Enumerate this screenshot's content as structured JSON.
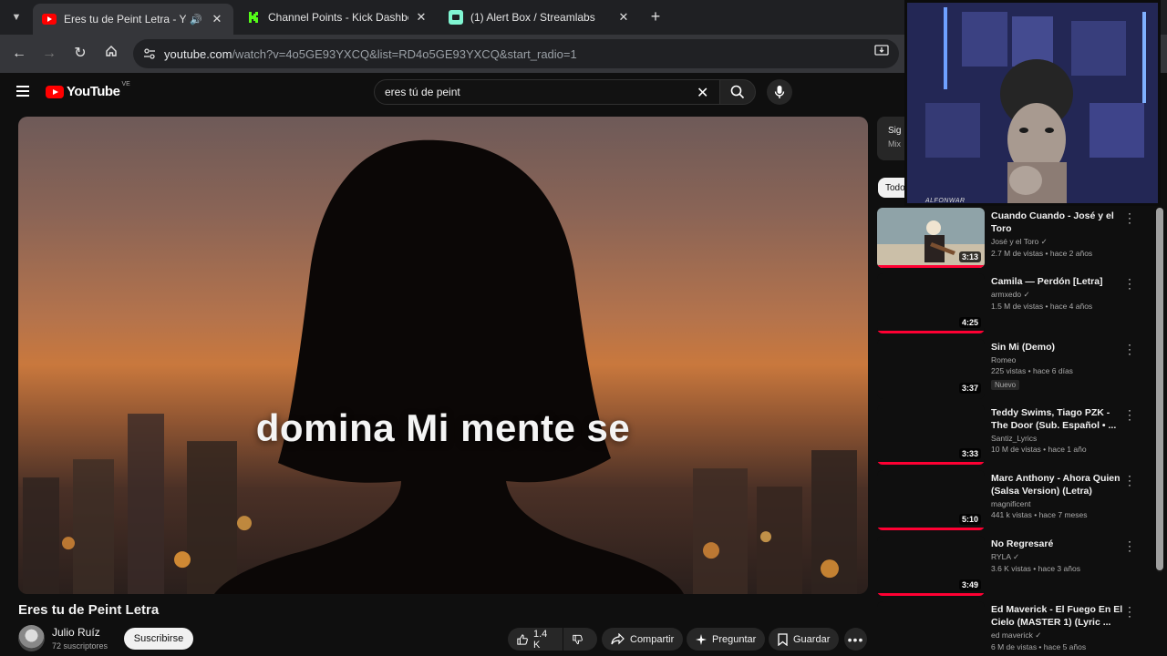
{
  "browser": {
    "tabs": [
      {
        "title": "Eres tu de Peint Letra - YouTube",
        "favicon": "youtube-favicon",
        "active": true
      },
      {
        "title": "Channel Points - Kick Dashboard",
        "favicon": "kick-favicon",
        "active": false
      },
      {
        "title": "(1) Alert Box / Streamlabs",
        "favicon": "streamlabs-favicon",
        "active": false
      }
    ],
    "url": {
      "host": "youtube.com",
      "path": "/watch?v=4o5GE93YXCQ&list=RD4o5GE93YXCQ&start_radio=1"
    }
  },
  "youtube": {
    "logo_text": "YouTube",
    "country_code": "VE",
    "search_value": "eres tú de peint"
  },
  "video": {
    "lyric": "domina Mi mente se",
    "title": "Eres tu de Peint Letra",
    "channel": "Julio Ruíz",
    "subscribers": "72 suscriptores",
    "subscribe_label": "Suscribirse",
    "likes": "1.4 K",
    "share_label": "Compartir",
    "ask_label": "Preguntar",
    "save_label": "Guardar"
  },
  "sidebar": {
    "top_line1": "Sig",
    "top_line2": "Mix",
    "chip": "Todo"
  },
  "webcam": {
    "tag": "ALFONWAR"
  },
  "recommendations": [
    {
      "title": "Cuando Cuando - José y el Toro",
      "channel": "José y el Toro",
      "verified": true,
      "meta": "2.7 M de vistas • hace 2 años",
      "duration": "3:13",
      "badge": "",
      "progress": 1.0
    },
    {
      "title": "Camila — Perdón [Letra]",
      "channel": "armxedo",
      "verified": true,
      "meta": "1.5 M de vistas • hace 4 años",
      "duration": "4:25",
      "badge": "",
      "progress": 1.0
    },
    {
      "title": "Sin Mi (Demo)",
      "channel": "Romeo",
      "verified": false,
      "meta": "225 vistas • hace 6 días",
      "duration": "3:37",
      "badge": "Nuevo",
      "progress": 0
    },
    {
      "title": "Teddy Swims, Tiago PZK - The Door (Sub. Español • ...",
      "channel": "Santiz_Lyrics",
      "verified": false,
      "meta": "10 M de vistas • hace 1 año",
      "duration": "3:33",
      "badge": "",
      "progress": 1.0
    },
    {
      "title": "Marc Anthony - Ahora Quien (Salsa Version) (Letra)",
      "channel": "magnificent",
      "verified": false,
      "meta": "441 k vistas • hace 7 meses",
      "duration": "5:10",
      "badge": "",
      "progress": 1.0
    },
    {
      "title": "No Regresaré",
      "channel": "RYLA",
      "verified": true,
      "meta": "3.6 K vistas • hace 3 años",
      "duration": "3:49",
      "badge": "",
      "progress": 1.0
    },
    {
      "title": "Ed Maverick - El Fuego En El Cielo (MASTER 1) (Lyric ...",
      "channel": "ed maverick",
      "verified": true,
      "meta": "6 M de vistas • hace 5 años",
      "duration": "",
      "badge": "",
      "progress": 0
    }
  ],
  "colors": {
    "accent": "#ff0033",
    "background": "#0f0f0f"
  }
}
